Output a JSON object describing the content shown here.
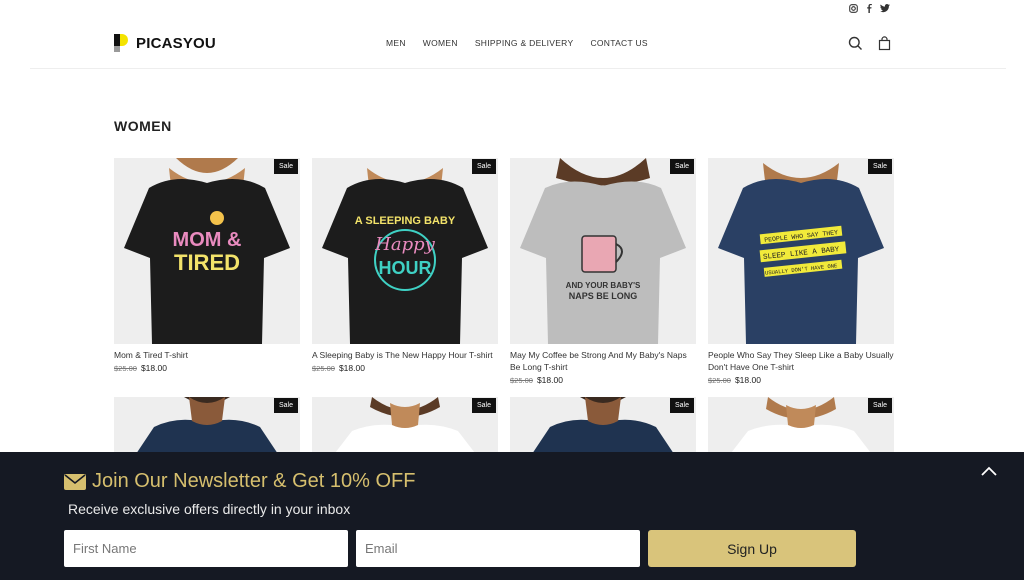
{
  "header": {
    "brand": "PICASYOU",
    "nav": [
      "MEN",
      "WOMEN",
      "SHIPPING & DELIVERY",
      "CONTACT US"
    ],
    "icons": [
      "search-icon",
      "cart-icon"
    ],
    "social_icons": [
      "instagram-icon",
      "facebook-icon",
      "twitter-icon"
    ]
  },
  "section_title": "WOMEN",
  "products": [
    {
      "name": "Mom & Tired T-shirt",
      "old_price": "$25.00",
      "price": "$18.00",
      "badge": "Sale",
      "shirt_color": "#1c1c1c",
      "print_lines": [
        "MOM &",
        "TIRED"
      ],
      "print_color": "#e98bbf"
    },
    {
      "name": "A Sleeping Baby is The New Happy Hour T-shirt",
      "old_price": "$25.00",
      "price": "$18.00",
      "badge": "Sale",
      "shirt_color": "#1c1c1c",
      "print_lines": [
        "A SLEEPING BABY",
        "Happy",
        "HOUR"
      ],
      "print_color": "#f3e36a"
    },
    {
      "name": "May My Coffee be Strong And My Baby's Naps Be Long T-shirt",
      "old_price": "$25.00",
      "price": "$18.00",
      "badge": "Sale",
      "shirt_color": "#bdbdbd",
      "print_lines": [
        "AND YOUR BABY'S",
        "NAPS BE LONG"
      ],
      "print_color": "#333333"
    },
    {
      "name": "People Who Say They Sleep Like a Baby Usually Don't Have One T-shirt",
      "old_price": "$25.00",
      "price": "$18.00",
      "badge": "Sale",
      "shirt_color": "#2a4064",
      "print_lines": [
        "PEOPLE WHO SAY THEY",
        "SLEEP LIKE A BABY",
        "USUALLY DON'T HAVE ONE"
      ],
      "print_color": "#f1ea3a"
    }
  ],
  "second_row": [
    {
      "badge": "Sale",
      "shirt_color": "#1f3350"
    },
    {
      "badge": "Sale",
      "shirt_color": "#ffffff"
    },
    {
      "badge": "Sale",
      "shirt_color": "#1f3350"
    },
    {
      "badge": "Sale",
      "shirt_color": "#ffffff"
    }
  ],
  "newsletter": {
    "title": "Join Our Newsletter & Get 10% OFF",
    "subtitle": "Receive exclusive offers directly in your inbox",
    "first_name_placeholder": "First Name",
    "email_placeholder": "Email",
    "button": "Sign Up",
    "accent": "#d6bf6e",
    "background": "#151923"
  }
}
